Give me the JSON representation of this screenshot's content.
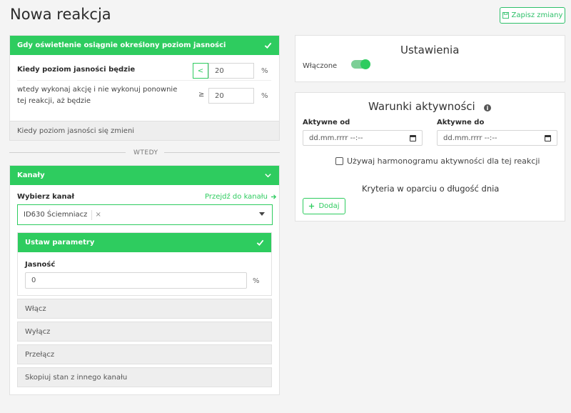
{
  "page": {
    "title": "Nowa reakcja",
    "save_label": "Zapisz zmiany"
  },
  "trigger": {
    "header": "Gdy oświetlenie osiągnie określony poziom jasności",
    "row1_label": "Kiedy poziom jasności będzie",
    "row1_operator": "<",
    "row1_value": "20",
    "row1_unit": "%",
    "row2_label": "wtedy wykonaj akcję i nie wykonuj ponownie tej reakcji, aż będzie",
    "row2_operator": "≥",
    "row2_value": "20",
    "row2_unit": "%",
    "alt_option": "Kiedy poziom jasności się zmieni"
  },
  "divider": "WTEDY",
  "channels": {
    "header": "Kanały",
    "select_label": "Wybierz kanał",
    "go_to_channel": "Przejdź do kanału",
    "selected_channel": "ID630 Ściemniacz",
    "remove_tag": "×",
    "params": {
      "header": "Ustaw parametry",
      "brightness_label": "Jasność",
      "brightness_value": "0",
      "brightness_unit": "%"
    },
    "actions": [
      "Włącz",
      "Wyłącz",
      "Przełącz",
      "Skopiuj stan z innego kanału"
    ]
  },
  "settings": {
    "title": "Ustawienia",
    "enabled_label": "Włączone",
    "enabled": true
  },
  "activity": {
    "title": "Warunki aktywności",
    "info_icon": "i",
    "from_label": "Aktywne od",
    "from_placeholder": "dd.mm.rrrr --:--",
    "to_label": "Aktywne do",
    "to_placeholder": "dd.mm.rrrr --:--",
    "schedule_label": "Używaj harmonogramu aktywności dla tej reakcji",
    "daylight_title": "Kryteria w oparciu o długość dnia",
    "add_label": "Dodaj"
  },
  "colors": {
    "accent": "#2ecc5f",
    "toggle_track": "#7ccf96"
  }
}
